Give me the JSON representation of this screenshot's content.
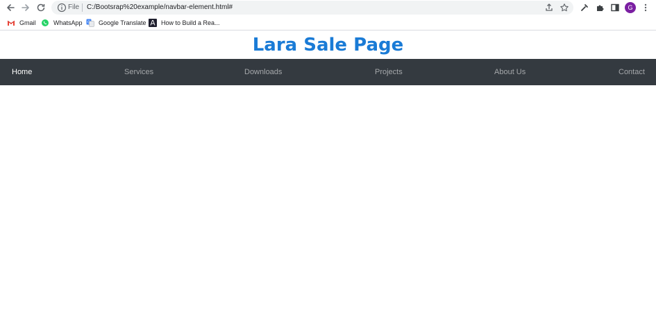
{
  "browser": {
    "scheme_label": "File",
    "url": "C:/Bootsrap%20example/navbar-element.html#",
    "avatar_initial": "G",
    "icons": [
      "back-icon",
      "forward-icon",
      "reload-icon",
      "info-icon",
      "share-icon",
      "star-icon",
      "eyedropper-icon",
      "extensions-icon",
      "sidepanel-icon",
      "menu-icon"
    ]
  },
  "bookmarks": {
    "items": [
      {
        "label": "Gmail",
        "icon": "gmail-icon"
      },
      {
        "label": "WhatsApp",
        "icon": "whatsapp-icon"
      },
      {
        "label": "Google Translate",
        "icon": "translate-icon"
      },
      {
        "label": "How to Build a Rea...",
        "icon": "bookmark-site-icon"
      }
    ]
  },
  "page": {
    "title": "Lara Sale Page",
    "title_color": "#1a7bd6",
    "navbar_color": "#343a40",
    "nav": [
      {
        "label": "Home",
        "active": true
      },
      {
        "label": "Services",
        "active": false
      },
      {
        "label": "Downloads",
        "active": false
      },
      {
        "label": "Projects",
        "active": false
      },
      {
        "label": "About Us",
        "active": false
      },
      {
        "label": "Contact",
        "active": false
      }
    ]
  }
}
